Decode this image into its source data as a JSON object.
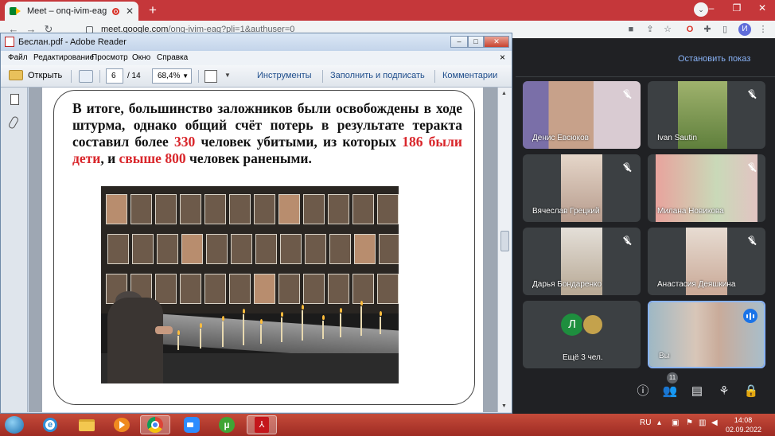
{
  "browser": {
    "tab_title": "Meet – onq-ivim-eag",
    "url_host": "meet.google.com",
    "url_path": "/onq-ivim-eag?pli=1&authuser=0",
    "profile_initial": "И"
  },
  "meet": {
    "stop_presenting_label": "Остановить показ",
    "participants": [
      {
        "name": "Денис Евсюков"
      },
      {
        "name": "Ivan Sautin"
      },
      {
        "name": "Вячеслав Грецкий"
      },
      {
        "name": "Милана Новикова"
      },
      {
        "name": "Дарья Бондаренко"
      },
      {
        "name": "Анастасия Деяшкина"
      }
    ],
    "more_tile": {
      "avatar_initial": "Л",
      "label": "Ещё 3 чел."
    },
    "self_tile": {
      "label": "Вы"
    },
    "people_count": "11"
  },
  "reader": {
    "window_title": "Беслан.pdf - Adobe Reader",
    "menu": [
      "Файл",
      "Редактирование",
      "Просмотр",
      "Окно",
      "Справка"
    ],
    "open_label": "Открыть",
    "page_current": "6",
    "page_total": "/ 14",
    "zoom": "68,4%",
    "tools_label": "Инструменты",
    "fill_sign_label": "Заполнить и подписать",
    "comments_label": "Комментарии"
  },
  "slide": {
    "text_1": "В итоге, большинство заложников были освобождены в ходе штурма, однако общий счёт потерь в результате теракта составил более ",
    "num_330": "330",
    "text_2": " человек убитыми, из которых ",
    "children_186": "186 были дети",
    "text_3": ", и ",
    "over_800": "свыше 800",
    "text_4": " человек ранеными."
  },
  "taskbar": {
    "lang": "RU",
    "time": "14:08",
    "date": "02.09.2022"
  }
}
